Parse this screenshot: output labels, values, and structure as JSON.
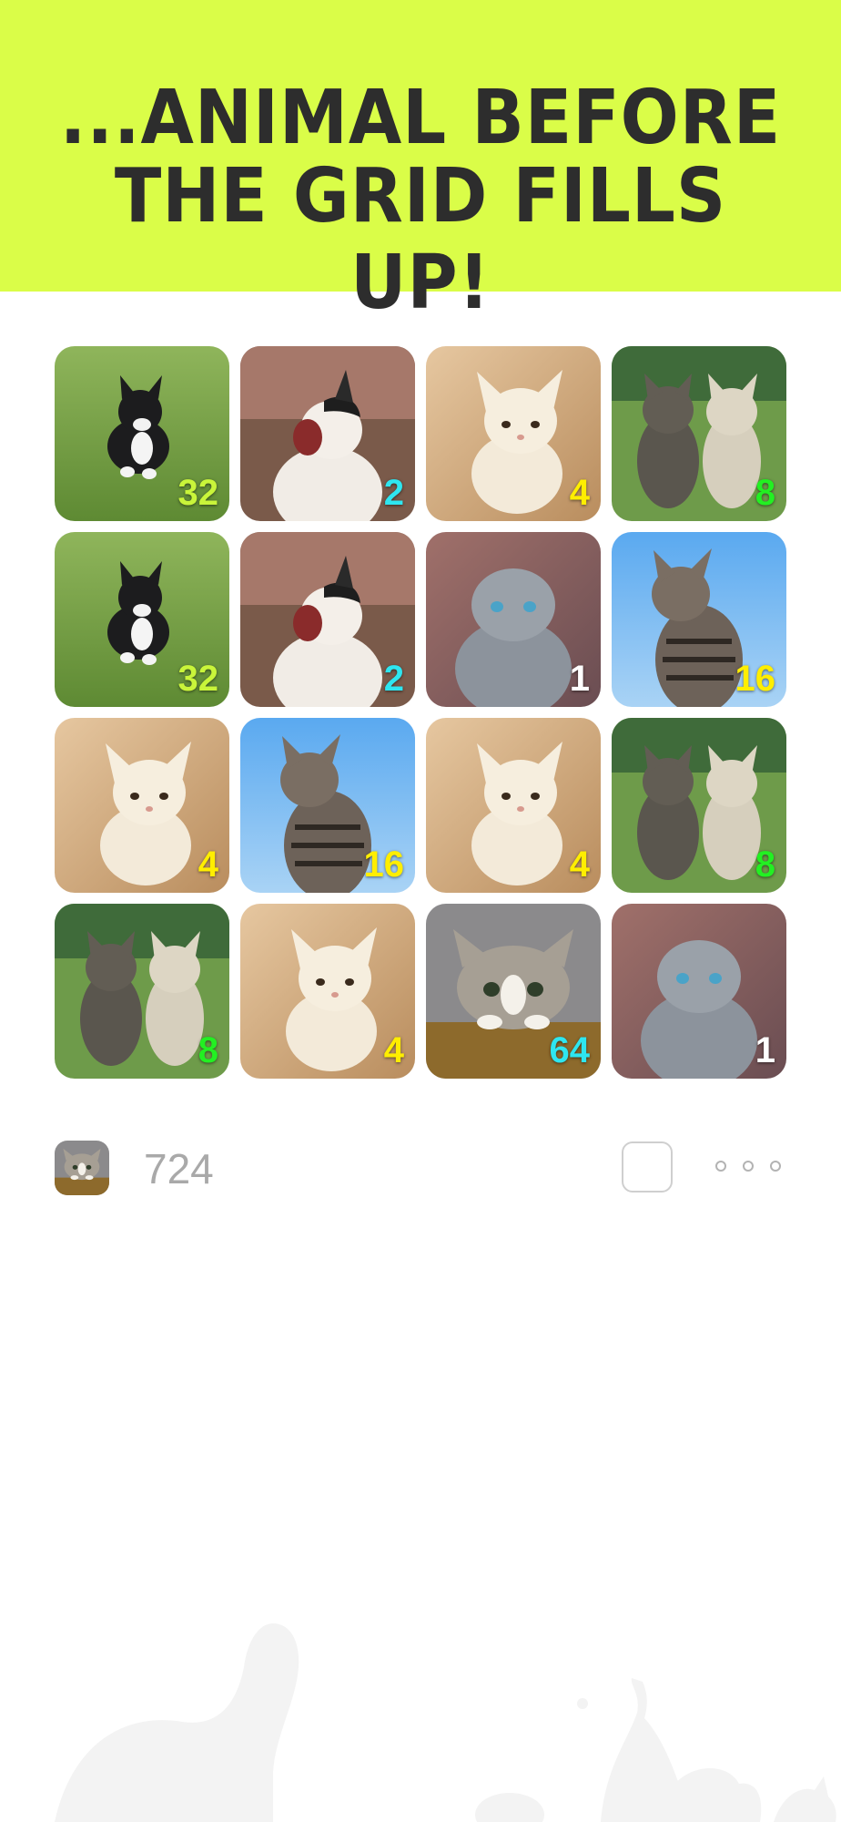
{
  "banner": {
    "line1": "...ANIMAL BEFORE",
    "line2": "THE GRID FILLS UP!",
    "background": "#dafd48"
  },
  "grid": {
    "rows": [
      [
        {
          "value": "32",
          "kitten": "black-and-white-kitten-on-grass",
          "label_color": "#c9f53a"
        },
        {
          "value": "2",
          "kitten": "yawning-white-kitten",
          "label_color": "#2ee6f0"
        },
        {
          "value": "4",
          "kitten": "cream-kitten",
          "label_color": "#ffee00"
        },
        {
          "value": "8",
          "kitten": "two-tabby-kittens",
          "label_color": "#22f022"
        }
      ],
      [
        {
          "value": "32",
          "kitten": "black-and-white-kitten-on-grass",
          "label_color": "#c9f53a"
        },
        {
          "value": "2",
          "kitten": "yawning-white-kitten",
          "label_color": "#2ee6f0"
        },
        {
          "value": "1",
          "kitten": "grey-scottish-fold-kitten",
          "label_color": "#ffffff"
        },
        {
          "value": "16",
          "kitten": "tabby-kitten-blue-sky",
          "label_color": "#ffee00"
        }
      ],
      [
        {
          "value": "4",
          "kitten": "cream-kitten",
          "label_color": "#ffee00"
        },
        {
          "value": "16",
          "kitten": "tabby-kitten-blue-sky",
          "label_color": "#ffee00"
        },
        {
          "value": "4",
          "kitten": "cream-kitten",
          "label_color": "#ffee00"
        },
        {
          "value": "8",
          "kitten": "two-tabby-kittens",
          "label_color": "#22f022"
        }
      ],
      [
        {
          "value": "8",
          "kitten": "two-tabby-kittens",
          "label_color": "#22f022"
        },
        {
          "value": "4",
          "kitten": "cream-kitten",
          "label_color": "#ffee00"
        },
        {
          "value": "64",
          "kitten": "peeking-tabby-kitten",
          "label_color": "#2ee6f0"
        },
        {
          "value": "1",
          "kitten": "grey-scottish-fold-kitten",
          "label_color": "#ffffff"
        }
      ]
    ]
  },
  "bottom_bar": {
    "score": "724",
    "current_icon": "peeking-tabby-kitten"
  }
}
